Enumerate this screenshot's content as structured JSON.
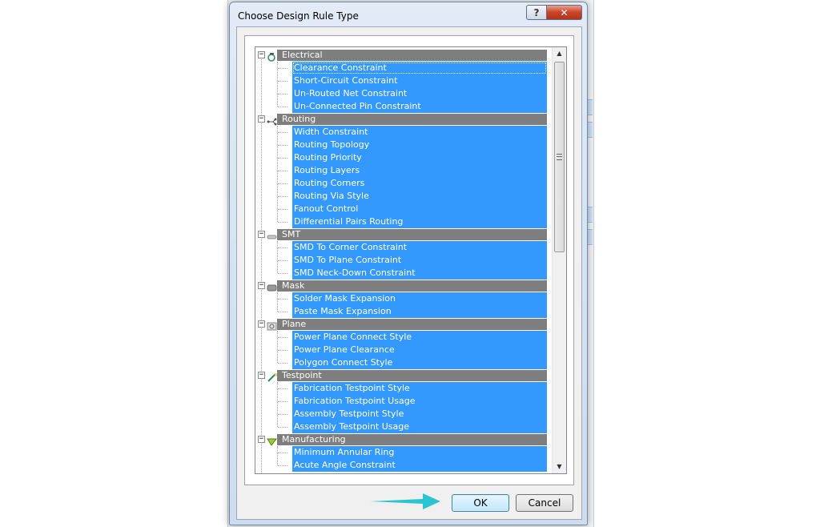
{
  "dialog": {
    "title": "Choose Design Rule Type",
    "help_label": "?",
    "close_label": "✕",
    "ok_label": "OK",
    "cancel_label": "Cancel"
  },
  "tree": {
    "categories": [
      {
        "label": "Electrical",
        "expander": "−",
        "icon": "electrical-icon",
        "items": [
          "Clearance Constraint",
          "Short-Circuit Constraint",
          "Un-Routed Net Constraint",
          "Un-Connected Pin Constraint"
        ]
      },
      {
        "label": "Routing",
        "expander": "−",
        "icon": "routing-icon",
        "items": [
          "Width Constraint",
          "Routing Topology",
          "Routing Priority",
          "Routing Layers",
          "Routing Corners",
          "Routing Via Style",
          "Fanout Control",
          "Differential Pairs Routing"
        ]
      },
      {
        "label": "SMT",
        "expander": "−",
        "icon": "smt-icon",
        "items": [
          "SMD To Corner Constraint",
          "SMD To Plane Constraint",
          "SMD Neck-Down Constraint"
        ]
      },
      {
        "label": "Mask",
        "expander": "−",
        "icon": "mask-icon",
        "items": [
          "Solder Mask Expansion",
          "Paste Mask Expansion"
        ]
      },
      {
        "label": "Plane",
        "expander": "−",
        "icon": "plane-icon",
        "items": [
          "Power Plane Connect Style",
          "Power Plane Clearance",
          "Polygon Connect Style"
        ]
      },
      {
        "label": "Testpoint",
        "expander": "−",
        "icon": "testpoint-icon",
        "items": [
          "Fabrication Testpoint Style",
          "Fabrication Testpoint Usage",
          "Assembly Testpoint Style",
          "Assembly Testpoint Usage"
        ]
      },
      {
        "label": "Manufacturing",
        "expander": "−",
        "icon": "manufacturing-icon",
        "items": [
          "Minimum Annular Ring",
          "Acute Angle Constraint"
        ]
      }
    ]
  },
  "scrollbar": {
    "up_glyph": "▲",
    "down_glyph": "▼"
  },
  "colors": {
    "selection": "#3399ff",
    "category_bg": "#7e7e7e",
    "arrow": "#2bc4d1"
  }
}
